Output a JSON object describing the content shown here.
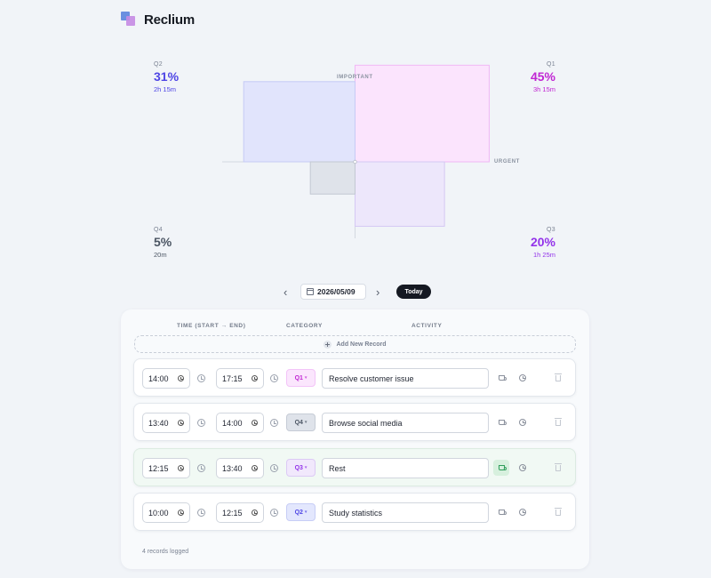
{
  "app": {
    "name": "Reclium"
  },
  "matrix": {
    "axis_important": "IMPORTANT",
    "axis_urgent": "URGENT",
    "quadrants": [
      {
        "id": "Q1",
        "percent": "45%",
        "time": "3h 15m",
        "share": 0.45,
        "color": "#c026d3",
        "fill": "#fbe4fd",
        "stroke": "#f0b8f5"
      },
      {
        "id": "Q2",
        "percent": "31%",
        "time": "2h 15m",
        "share": 0.31,
        "color": "#4f46e5",
        "fill": "#e1e4fc",
        "stroke": "#c6cbf5"
      },
      {
        "id": "Q3",
        "percent": "20%",
        "time": "1h 25m",
        "share": 0.2,
        "color": "#9333ea",
        "fill": "#ede7fb",
        "stroke": "#d4c8f3"
      },
      {
        "id": "Q4",
        "percent": "5%",
        "time": "20m",
        "share": 0.05,
        "color": "#4b5563",
        "fill": "#dfe3ea",
        "stroke": "#c2c8d2"
      }
    ]
  },
  "date_nav": {
    "date": "2026/05/09",
    "today_label": "Today"
  },
  "table": {
    "headers": {
      "time": "TIME (START → END)",
      "category": "CATEGORY",
      "activity": "ACTIVITY"
    },
    "add_label": "Add New Record",
    "records": [
      {
        "start": "14:00",
        "end": "17:15",
        "category": "Q1",
        "activity": "Resolve customer issue",
        "break_active": false
      },
      {
        "start": "13:40",
        "end": "14:00",
        "category": "Q4",
        "activity": "Browse social media",
        "break_active": false
      },
      {
        "start": "12:15",
        "end": "13:40",
        "category": "Q3",
        "activity": "Rest",
        "break_active": true
      },
      {
        "start": "10:00",
        "end": "12:15",
        "category": "Q2",
        "activity": "Study statistics",
        "break_active": false
      }
    ],
    "footer": "4 records logged"
  },
  "category_styles": {
    "Q1": {
      "bg": "#fbe6fd",
      "fg": "#c026d3",
      "border": "#f3c4f8"
    },
    "Q2": {
      "bg": "#e3e7fd",
      "fg": "#4f46e5",
      "border": "#c7cdf6"
    },
    "Q3": {
      "bg": "#f1e8fc",
      "fg": "#9333ea",
      "border": "#dccaf5"
    },
    "Q4": {
      "bg": "#dfe3ea",
      "fg": "#4b5563",
      "border": "#c6ccd6"
    }
  }
}
